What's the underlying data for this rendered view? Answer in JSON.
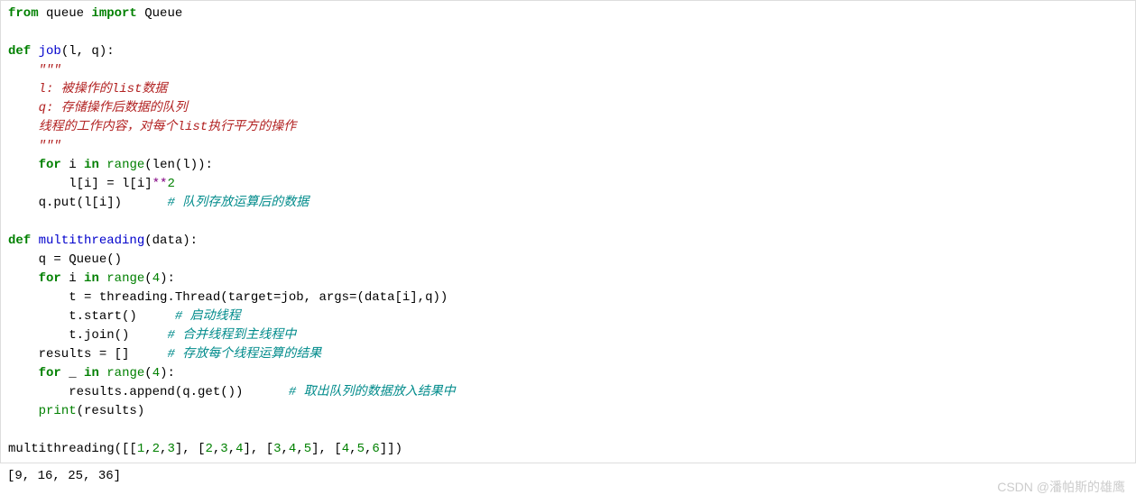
{
  "code": {
    "line1": {
      "from": "from",
      "queue": " queue ",
      "import": "import",
      "Queue": " Queue"
    },
    "line3": {
      "def": "def",
      "job": " job",
      "params": "(l, q):"
    },
    "line4": "    \"\"\"",
    "line5": "    l: 被操作的list数据",
    "line6": "    q: 存储操作后数据的队列",
    "line7": "    线程的工作内容，对每个list执行平方的操作",
    "line8": "    \"\"\"",
    "line9": {
      "indent": "    ",
      "for": "for",
      "i": " i ",
      "in": "in",
      "range": " range",
      "call": "(len(l)):"
    },
    "line10": {
      "indent": "        l[i] = l[i]",
      "op": "**",
      "num": "2"
    },
    "line11": {
      "indent": "    q.put(l[i])      ",
      "cmt": "# 队列存放运算后的数据"
    },
    "line13": {
      "def": "def",
      "mt": " multithreading",
      "params": "(data):"
    },
    "line14": "    q = Queue()",
    "line15": {
      "indent": "    ",
      "for": "for",
      "i": " i ",
      "in": "in",
      "range": " range",
      "open": "(",
      "num": "4",
      "close": "):"
    },
    "line16": {
      "indent": "        t = threading.Thread(target=job, args=(data[i],q))"
    },
    "line17": {
      "indent": "        t.start()     ",
      "cmt": "# 启动线程"
    },
    "line18": {
      "indent": "        t.join()     ",
      "cmt": "# 合并线程到主线程中"
    },
    "line19": {
      "indent": "    results = []     ",
      "cmt": "# 存放每个线程运算的结果"
    },
    "line20": {
      "indent": "    ",
      "for": "for",
      "u": " _ ",
      "in": "in",
      "range": " range",
      "open": "(",
      "num": "4",
      "close": "):"
    },
    "line21": {
      "indent": "        results.append(q.get())      ",
      "cmt": "# 取出队列的数据放入结果中"
    },
    "line22": {
      "indent": "    ",
      "print": "print",
      "args": "(results)"
    },
    "line24": {
      "call": "multithreading([[",
      "n1": "1",
      "c1": ",",
      "n2": "2",
      "c2": ",",
      "n3": "3",
      "c3": "], [",
      "n4": "2",
      "c4": ",",
      "n5": "3",
      "c5": ",",
      "n6": "4",
      "c6": "], [",
      "n7": "3",
      "c7": ",",
      "n8": "4",
      "c8": ",",
      "n9": "5",
      "c9": "], [",
      "n10": "4",
      "c10": ",",
      "n11": "5",
      "c11": ",",
      "n12": "6",
      "c12": "]])"
    }
  },
  "output": "[9, 16, 25, 36]",
  "watermark": "CSDN @潘帕斯的雄鹰"
}
